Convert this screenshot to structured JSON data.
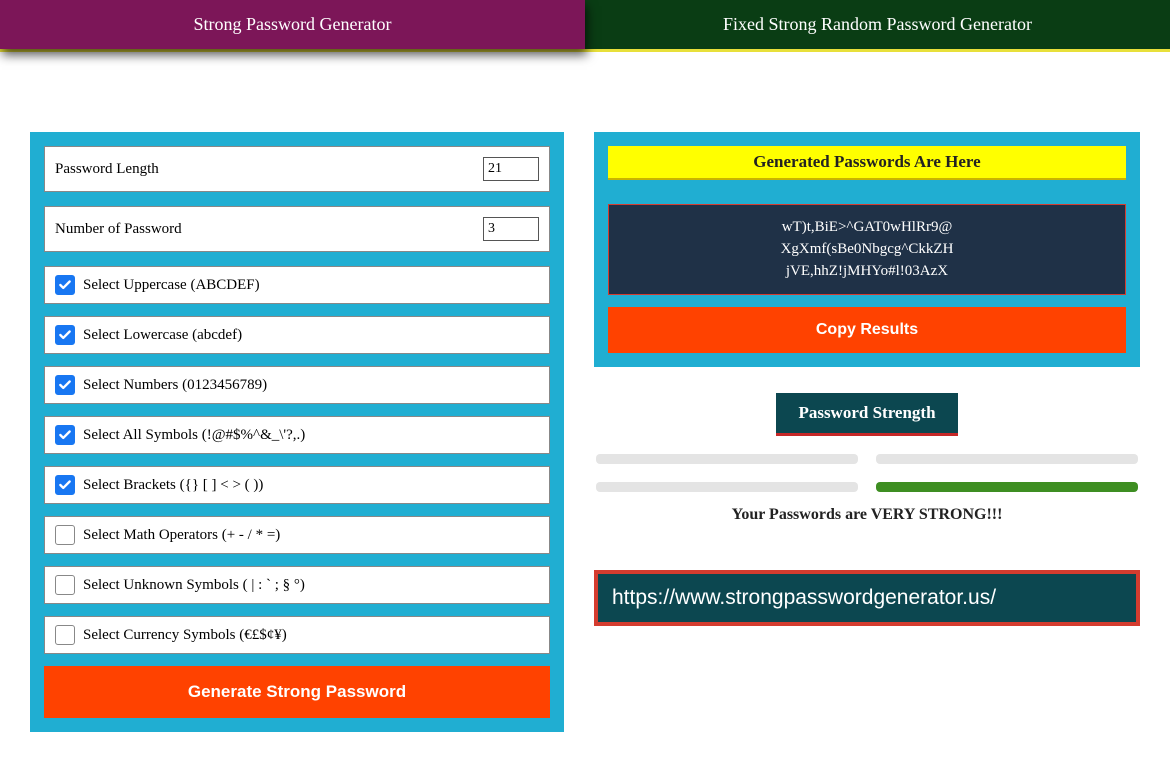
{
  "tabs": {
    "left": "Strong Password Generator",
    "right": "Fixed Strong Random Password Generator"
  },
  "fields": {
    "length_label": "Password Length",
    "length_value": "21",
    "count_label": "Number of Password",
    "count_value": "3"
  },
  "options": [
    {
      "label": "Select Uppercase (ABCDEF)",
      "checked": true
    },
    {
      "label": "Select Lowercase (abcdef)",
      "checked": true
    },
    {
      "label": "Select Numbers (0123456789)",
      "checked": true
    },
    {
      "label": "Select All Symbols (!@#$%^&_\\'?,.)",
      "checked": true
    },
    {
      "label": "Select Brackets ({} [ ] < > ( ))",
      "checked": true
    },
    {
      "label": "Select Math Operators (+ - / * =)",
      "checked": false
    },
    {
      "label": "Select Unknown Symbols ( | : ` ; § °)",
      "checked": false
    },
    {
      "label": "Select Currency Symbols (€£$¢¥)",
      "checked": false
    }
  ],
  "generate_button": "Generate Strong Password",
  "results": {
    "header": "Generated Passwords Are Here",
    "passwords": [
      "wT)t,BiE>^GAT0wHlRr9@",
      "XgXmf(sBe0Nbgcg^CkkZH",
      "jVE,hhZ!jMHYo#l!03AzX"
    ],
    "copy_button": "Copy Results"
  },
  "strength": {
    "badge": "Password Strength",
    "text": "Your Passwords are VERY STRONG!!!"
  },
  "url": "https://www.strongpasswordgenerator.us/"
}
